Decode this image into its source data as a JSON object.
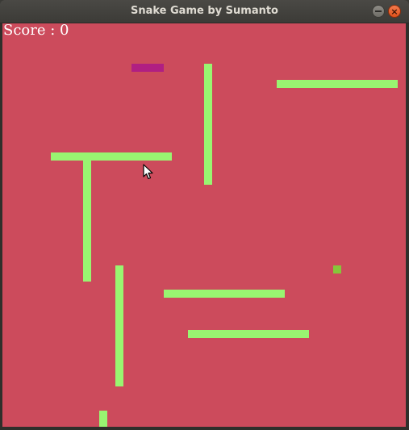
{
  "window": {
    "title": "Snake Game by Sumanto",
    "minimize_icon": "minimize-icon",
    "close_icon": "close-icon",
    "close_glyph": "×",
    "close_color": "#e95420"
  },
  "game": {
    "score_label": "Score : 0",
    "score": 0,
    "background_color": "#cc4b5c",
    "wall_color": "#99f571",
    "snake_color": "#b01f82",
    "food_color": "#86c63a"
  }
}
